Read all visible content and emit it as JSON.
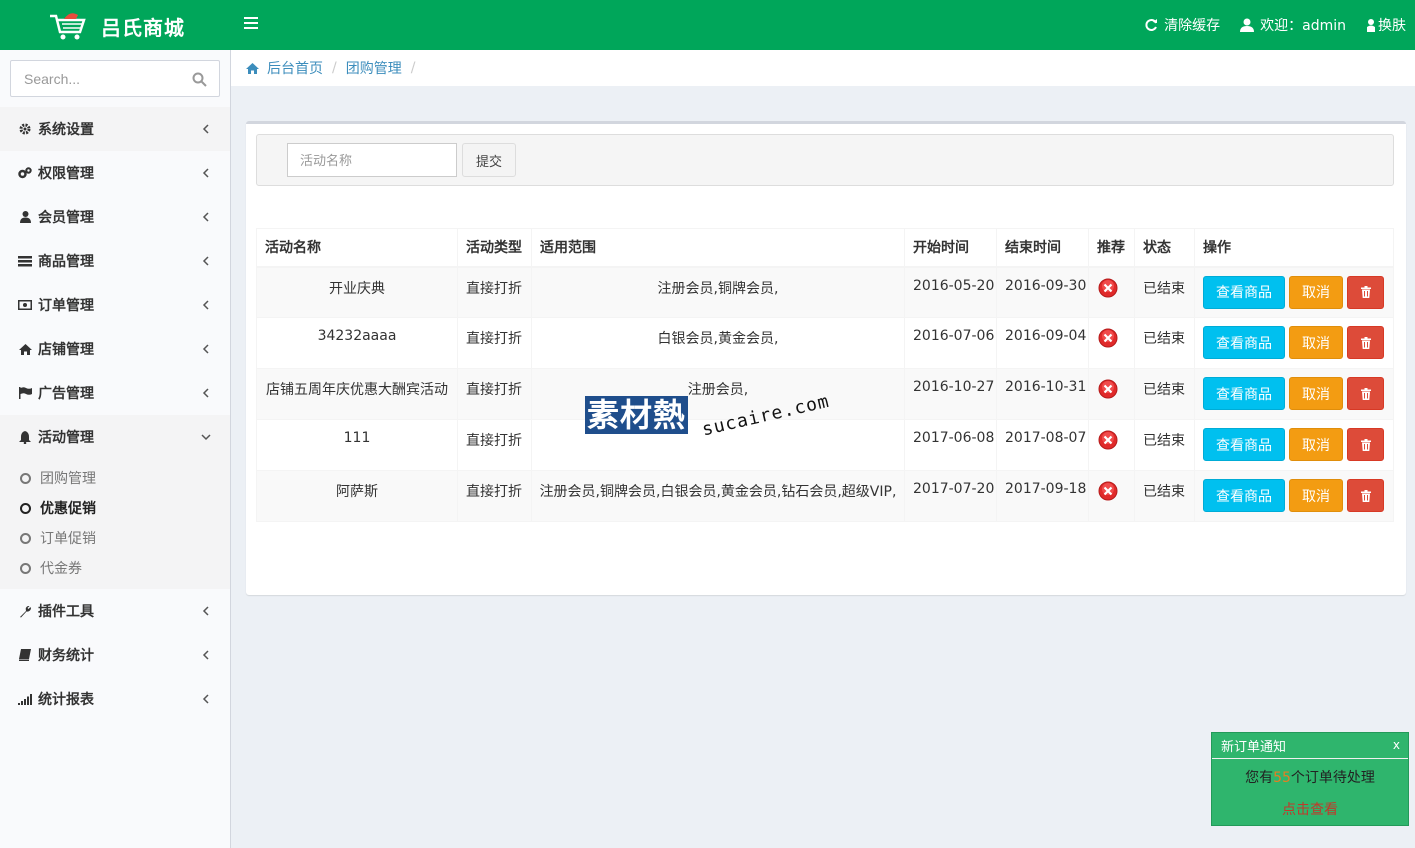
{
  "header": {
    "logo_text": "吕氏商城",
    "clear_cache": "清除缓存",
    "welcome": "欢迎：admin",
    "skin": "换肤"
  },
  "sidebar": {
    "search_placeholder": "Search...",
    "items": [
      {
        "label": "系统设置",
        "icon": "gear-icon"
      },
      {
        "label": "权限管理",
        "icon": "gears-icon"
      },
      {
        "label": "会员管理",
        "icon": "user-icon"
      },
      {
        "label": "商品管理",
        "icon": "list-icon"
      },
      {
        "label": "订单管理",
        "icon": "money-icon"
      },
      {
        "label": "店铺管理",
        "icon": "home-icon"
      },
      {
        "label": "广告管理",
        "icon": "flag-icon"
      },
      {
        "label": "活动管理",
        "icon": "bell-icon"
      },
      {
        "label": "插件工具",
        "icon": "wrench-icon"
      },
      {
        "label": "财务统计",
        "icon": "book-icon"
      },
      {
        "label": "统计报表",
        "icon": "signal-icon"
      }
    ],
    "sub_items": [
      "团购管理",
      "优惠促销",
      "订单促销",
      "代金券"
    ]
  },
  "breadcrumb": {
    "home": "后台首页",
    "current": "团购管理"
  },
  "filter": {
    "placeholder": "活动名称",
    "submit": "提交"
  },
  "table": {
    "headers": [
      "活动名称",
      "活动类型",
      "适用范围",
      "开始时间",
      "结束时间",
      "推荐",
      "状态",
      "操作"
    ],
    "rows": [
      {
        "name": "开业庆典",
        "type": "直接打折",
        "scope": "注册会员,铜牌会员,",
        "start": "2016-05-20",
        "end": "2016-09-30",
        "status": "已结束"
      },
      {
        "name": "34232aaaa",
        "type": "直接打折",
        "scope": "白银会员,黄金会员,",
        "start": "2016-07-06",
        "end": "2016-09-04",
        "status": "已结束"
      },
      {
        "name": "店铺五周年庆优惠大酬宾活动",
        "type": "直接打折",
        "scope": "注册会员,",
        "start": "2016-10-27",
        "end": "2016-10-31",
        "status": "已结束"
      },
      {
        "name": "111",
        "type": "直接打折",
        "scope": "",
        "start": "2017-06-08",
        "end": "2017-08-07",
        "status": "已结束"
      },
      {
        "name": "阿萨斯",
        "type": "直接打折",
        "scope": "注册会员,铜牌会员,白银会员,黄金会员,钻石会员,超级VIP,",
        "start": "2017-07-20",
        "end": "2017-09-18",
        "status": "已结束"
      }
    ],
    "actions": {
      "view": "查看商品",
      "cancel": "取消"
    }
  },
  "watermark": {
    "cn": "素材熱",
    "en": "sucaire.com"
  },
  "notice": {
    "title": "新订单通知",
    "close": "x",
    "prefix": "您有",
    "count": "55",
    "suffix": "个订单待处理",
    "link": "点击查看"
  },
  "colors": {
    "header": "#00a65a",
    "info": "#00c0ef",
    "warning": "#f39c12",
    "danger": "#dd4b39",
    "link": "#3c8dbc"
  }
}
